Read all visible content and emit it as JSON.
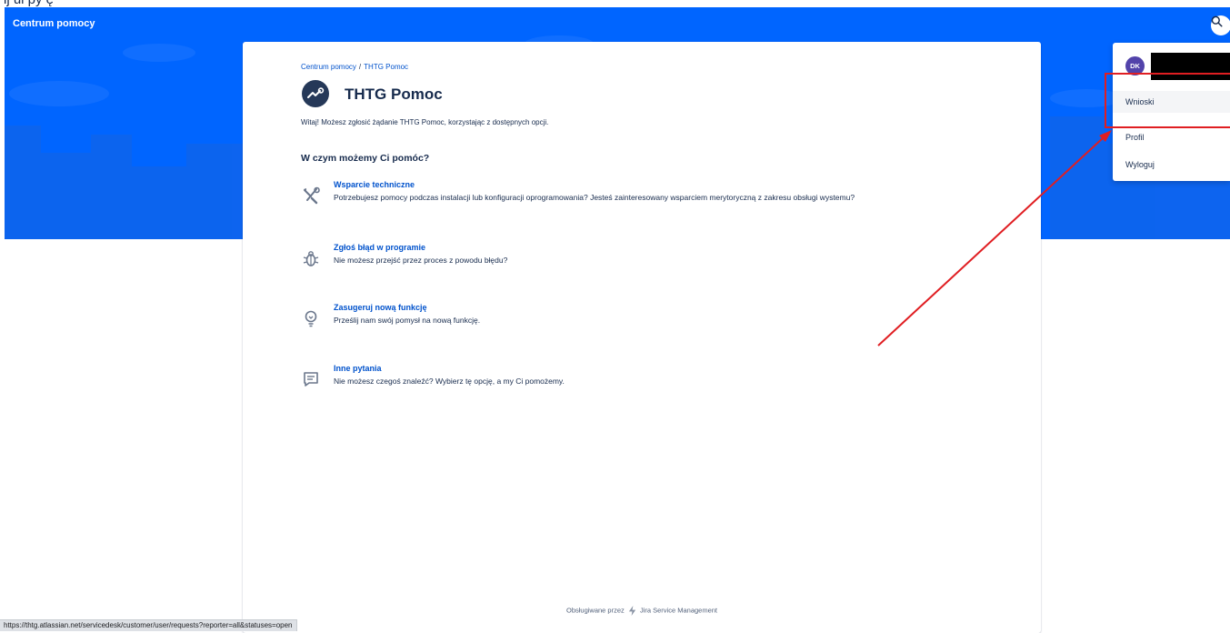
{
  "top_cut_text": "ij   ui  py  ę",
  "header": {
    "brand": "Centrum pomocy",
    "search_icon": "search-icon"
  },
  "breadcrumb": {
    "root": "Centrum pomocy",
    "separator": "/",
    "current": "THTG Pomoc"
  },
  "portal": {
    "title": "THTG Pomoc",
    "intro": "Witaj! Możesz zgłosić żądanie THTG Pomoc, korzystając z dostępnych opcji.",
    "section_heading": "W czym możemy Ci pomóc?"
  },
  "request_types": [
    {
      "name": "Wsparcie techniczne",
      "description": "Potrzebujesz pomocy podczas instalacji lub konfiguracji oprogramowania? Jesteś zainteresowany wsparciem merytoryczną z zakresu obsługi wystemu?",
      "icon": "tools-icon"
    },
    {
      "name": "Zgłoś błąd w programie",
      "description": "Nie możesz przejść przez proces z powodu błędu?",
      "icon": "bug-icon"
    },
    {
      "name": "Zasugeruj nową funkcję",
      "description": "Prześlij nam swój pomysł na nową funkcję.",
      "icon": "lightbulb-icon"
    },
    {
      "name": "Inne pytania",
      "description": "Nie możesz czegoś znaleźć? Wybierz tę opcję, a my Ci pomożemy.",
      "icon": "chat-icon"
    }
  ],
  "footer": {
    "prefix": "Obsługiwane przez",
    "product": "Jira Service Management"
  },
  "user_menu": {
    "initials": "DK",
    "items": [
      "Wnioski",
      "Profil",
      "Wyloguj"
    ]
  },
  "status_bar": {
    "url": "https://thtg.atlassian.net/servicedesk/customer/user/requests?reporter=all&statuses=open"
  },
  "colors": {
    "banner": "#0065ff",
    "link": "#0052cc",
    "text": "#172b4d",
    "annotation": "#e01e22",
    "avatar": "#5243aa"
  }
}
